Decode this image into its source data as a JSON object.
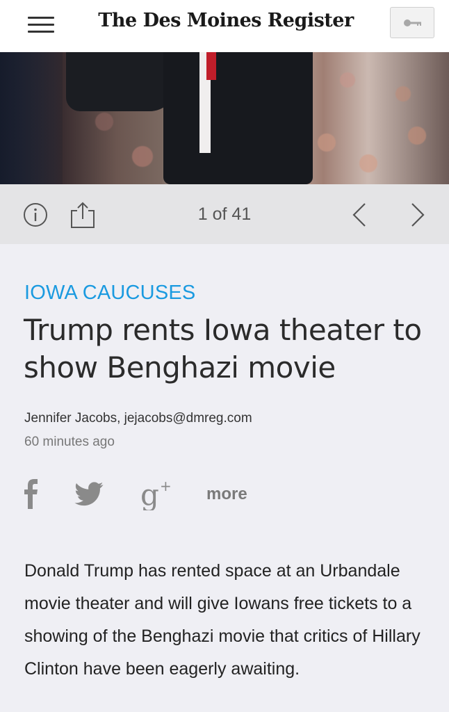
{
  "header": {
    "brand": "The Des Moines Register",
    "menu_icon": "hamburger-menu-icon",
    "key_icon": "key-icon"
  },
  "gallery": {
    "counter": "1 of 41",
    "icons": [
      "info-icon",
      "share-icon",
      "chevron-left-icon",
      "chevron-right-icon"
    ]
  },
  "article": {
    "section": "IOWA CAUCUSES",
    "headline": "Trump rents Iowa theater to show Benghazi movie",
    "byline": "Jennifer Jacobs, jejacobs@dmreg.com",
    "timestamp": "60 minutes ago",
    "share": {
      "icons": [
        "facebook-icon",
        "twitter-icon",
        "google-plus-icon"
      ],
      "more_label": "more"
    },
    "body": "Donald Trump has rented space at an Urbandale movie theater and will give Iowans free tickets to a showing of the Benghazi movie that critics of Hillary Clinton have been eagerly awaiting."
  },
  "colors": {
    "accent": "#1a9ae0",
    "background": "#efeff4",
    "toolbar": "#e4e4e6"
  }
}
